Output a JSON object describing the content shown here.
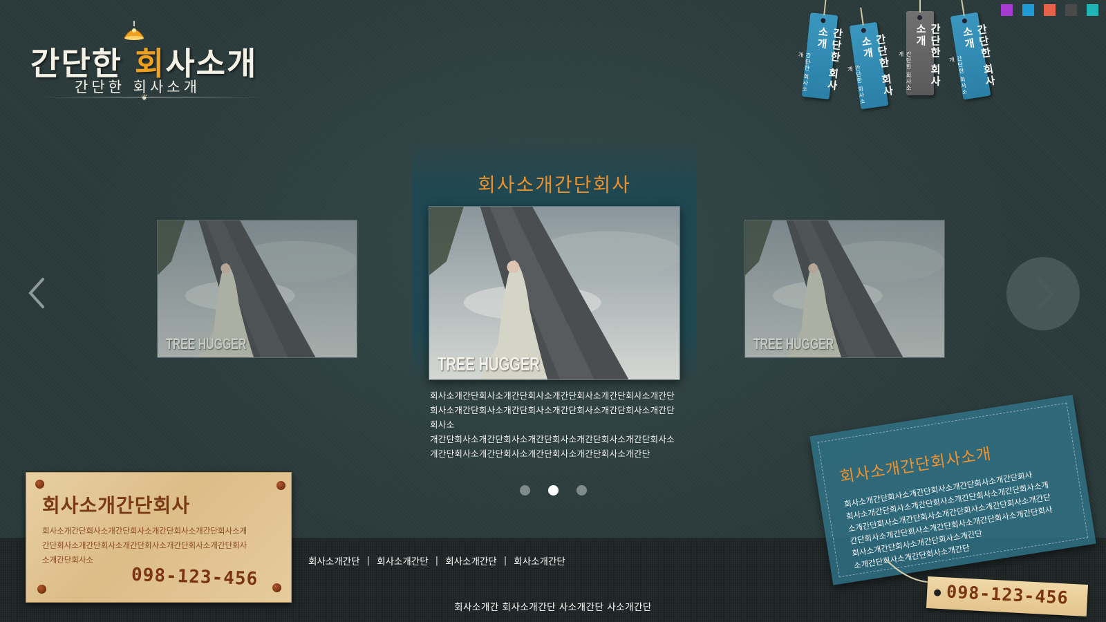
{
  "logo": {
    "main_pre": "간단한 ",
    "main_accent": "회",
    "main_post": "사소개",
    "sub": "간단한 회사소개"
  },
  "hanging_tags": [
    {
      "title": "간단한 회사소개",
      "sub": "간단한 회사소개",
      "color": "blue"
    },
    {
      "title": "간단한 회사소개",
      "sub": "간단한 회사소개",
      "color": "blue"
    },
    {
      "title": "간단한 회사소개",
      "sub": "간단한 회사소개",
      "color": "gray"
    },
    {
      "title": "간단한 회사소개",
      "sub": "간단한 회사소개",
      "color": "blue"
    }
  ],
  "swatches": [
    "#a53bd1",
    "#1f9ad6",
    "#e8624a",
    "#4a4a4a",
    "#1fb5b5"
  ],
  "carousel": {
    "title": "회사소개간단회사",
    "slides": [
      {
        "caption": "TREE HUGGER"
      },
      {
        "caption": "TREE HUGGER"
      },
      {
        "caption": "TREE HUGGER"
      }
    ],
    "description": [
      "회사소개간단회사소개간단회사소개간단회사소개간단회사소개간단",
      "회사소개간단회사소개간단회사소개간단회사소개간단회사소개간단",
      "회사소",
      "개간단회사소개간단회사소개간단회사소개간단회사소개간단회사소",
      "개간단회사소개간단회사소개간단회사소개간단회사소개간단"
    ],
    "dots": 3,
    "active_dot": 1
  },
  "wood_note": {
    "title": "회사소개간단회사",
    "body": [
      "회사소개간단회사소개간단회사소개간단회사소개간단회사소개",
      "간단회사소개간단회사소개간단회사소개간단회사소개간단회사",
      "소개간단회사소"
    ],
    "phone": "098-123-456"
  },
  "blue_card": {
    "title": "회사소개간단회사소개",
    "body": [
      "회사소개간단회사소개간단회사소개간단회사소개간단회사",
      "회사소개간단회사소개간단회사소개간단회사소개간단회사소개",
      "소개간단회사소개간단회사소개간단회사소개간단회사소개간단",
      "간단회사소개간단회사소개간단회사소개간단회사소개간단회사",
      "회사소개간단회사소개간단회사소개간단",
      "소개간단회사소개간단회사소개간단"
    ],
    "phone": "098-123-456"
  },
  "footer": {
    "links": [
      "회사소개간단",
      "회사소개간단",
      "회사소개간단",
      "회사소개간단"
    ],
    "copyright": "회사소개간 회사소개간단 사소개간단 사소개간단"
  }
}
